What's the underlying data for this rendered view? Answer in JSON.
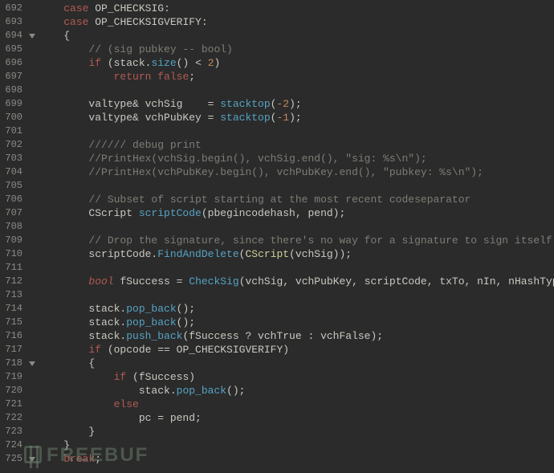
{
  "watermark_text": "FREEBUF",
  "lines": [
    {
      "num": 692,
      "fold": "",
      "ind": 0,
      "html": "<span class='kw'>case</span> OP_CHECKSIG:"
    },
    {
      "num": 693,
      "fold": "",
      "ind": 0,
      "html": "<span class='kw'>case</span> OP_CHECKSIGVERIFY:"
    },
    {
      "num": 694,
      "fold": "v",
      "ind": 0,
      "html": "{"
    },
    {
      "num": 695,
      "fold": "",
      "ind": 1,
      "html": "<span class='cm'>// (sig pubkey -- bool)</span>"
    },
    {
      "num": 696,
      "fold": "",
      "ind": 1,
      "html": "<span class='kw'>if</span> (stack.<span class='fn'>size</span>() &lt; <span class='num'>2</span>)"
    },
    {
      "num": 697,
      "fold": "",
      "ind": 2,
      "html": "<span class='kw'>return</span> <span class='kw'>false</span>;"
    },
    {
      "num": 698,
      "fold": "",
      "ind": 0,
      "html": ""
    },
    {
      "num": 699,
      "fold": "",
      "ind": 1,
      "html": "valtype&amp; vchSig    = <span class='fn'>stacktop</span>(<span class='num'>-2</span>);"
    },
    {
      "num": 700,
      "fold": "",
      "ind": 1,
      "html": "valtype&amp; vchPubKey = <span class='fn'>stacktop</span>(<span class='num'>-1</span>);"
    },
    {
      "num": 701,
      "fold": "",
      "ind": 0,
      "html": ""
    },
    {
      "num": 702,
      "fold": "",
      "ind": 1,
      "html": "<span class='cm'>////// debug print</span>"
    },
    {
      "num": 703,
      "fold": "",
      "ind": 1,
      "html": "<span class='cm'>//PrintHex(vchSig.begin(), vchSig.end(), \"sig: %s\\n\");</span>"
    },
    {
      "num": 704,
      "fold": "",
      "ind": 1,
      "html": "<span class='cm'>//PrintHex(vchPubKey.begin(), vchPubKey.end(), \"pubkey: %s\\n\");</span>"
    },
    {
      "num": 705,
      "fold": "",
      "ind": 0,
      "html": ""
    },
    {
      "num": 706,
      "fold": "",
      "ind": 1,
      "html": "<span class='cm'>// Subset of script starting at the most recent codeseparator</span>"
    },
    {
      "num": 707,
      "fold": "",
      "ind": 1,
      "html": "CScript <span class='fn'>scriptCode</span>(pbegincodehash, pend);"
    },
    {
      "num": 708,
      "fold": "",
      "ind": 0,
      "html": ""
    },
    {
      "num": 709,
      "fold": "",
      "ind": 1,
      "html": "<span class='cm'>// Drop the signature, since there's no way for a signature to sign itself</span>"
    },
    {
      "num": 710,
      "fold": "",
      "ind": 1,
      "html": "scriptCode.<span class='fn'>FindAndDelete</span>(<span class='call'>CScript</span>(vchSig));"
    },
    {
      "num": 711,
      "fold": "",
      "ind": 0,
      "html": ""
    },
    {
      "num": 712,
      "fold": "",
      "ind": 1,
      "html": "<span class='type'>bool</span> fSuccess = <span class='fn'>CheckSig</span>(vchSig, vchPubKey, scriptCode, txTo, nIn, nHashType);"
    },
    {
      "num": 713,
      "fold": "",
      "ind": 0,
      "html": ""
    },
    {
      "num": 714,
      "fold": "",
      "ind": 1,
      "html": "stack.<span class='fn'>pop_back</span>();"
    },
    {
      "num": 715,
      "fold": "",
      "ind": 1,
      "html": "stack.<span class='fn'>pop_back</span>();"
    },
    {
      "num": 716,
      "fold": "",
      "ind": 1,
      "html": "stack.<span class='fn'>push_back</span>(fSuccess ? vchTrue : vchFalse);"
    },
    {
      "num": 717,
      "fold": "",
      "ind": 1,
      "html": "<span class='kw'>if</span> (opcode == OP_CHECKSIGVERIFY)"
    },
    {
      "num": 718,
      "fold": "v",
      "ind": 1,
      "html": "{"
    },
    {
      "num": 719,
      "fold": "",
      "ind": 2,
      "html": "<span class='kw'>if</span> (fSuccess)"
    },
    {
      "num": 720,
      "fold": "",
      "ind": 3,
      "html": "stack.<span class='fn'>pop_back</span>();"
    },
    {
      "num": 721,
      "fold": "",
      "ind": 2,
      "html": "<span class='kw'>else</span>"
    },
    {
      "num": 722,
      "fold": "",
      "ind": 3,
      "html": "pc = pend;"
    },
    {
      "num": 723,
      "fold": "",
      "ind": 1,
      "html": "}"
    },
    {
      "num": 724,
      "fold": "",
      "ind": 0,
      "html": "}"
    },
    {
      "num": 725,
      "fold": "v",
      "ind": 0,
      "html": "<span class='kw'>break</span>;"
    }
  ]
}
